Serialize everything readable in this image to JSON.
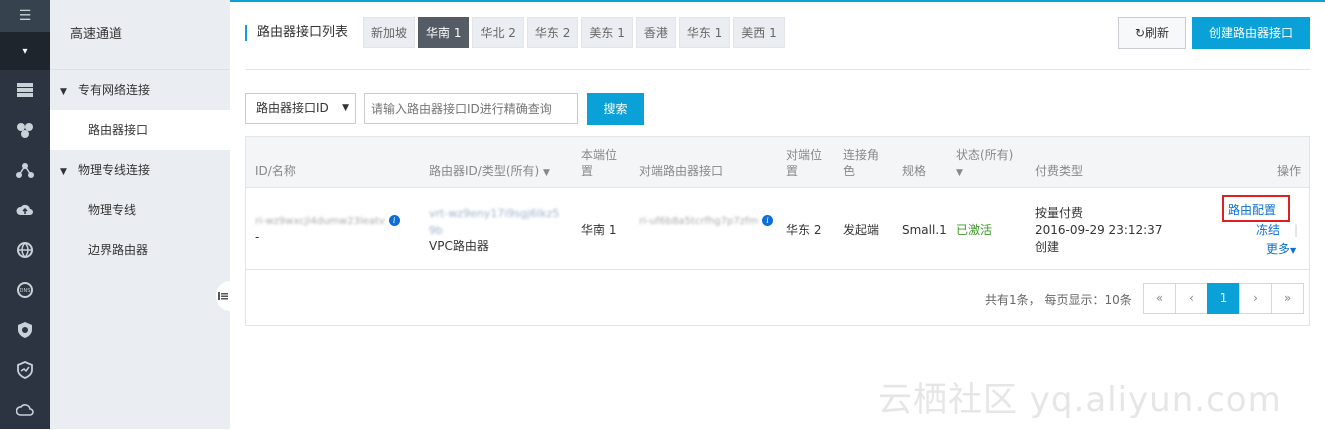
{
  "iconbar": {
    "menu_glyph": "☰",
    "collapse_glyph": "▾",
    "icons": [
      "server-icon",
      "cluster-icon",
      "network-icon",
      "cloud-upload-icon",
      "globe-icon",
      "dns-icon",
      "shield-icon",
      "security-icon",
      "cloud-icon"
    ]
  },
  "subnav": {
    "title": "高速通道",
    "group1": "专有网络连接",
    "item_router_iface": "路由器接口",
    "group2": "物理专线连接",
    "item_physical": "物理专线",
    "item_border": "边界路由器"
  },
  "header": {
    "title": "路由器接口列表",
    "regions": [
      "新加坡",
      "华南 1",
      "华北 2",
      "华东 2",
      "美东 1",
      "香港",
      "华东 1",
      "美西 1"
    ],
    "active_region": "华南 1",
    "refresh_label": "刷新",
    "create_label": "创建路由器接口"
  },
  "search": {
    "select_value": "路由器接口ID",
    "placeholder": "请输入路由器接口ID进行精确查询",
    "button_label": "搜索"
  },
  "table": {
    "headers": {
      "id_name": "ID/名称",
      "router": "路由器ID/类型(所有)",
      "local_pos": "本端位\n置",
      "peer_iface": "对端路由器接口",
      "peer_pos": "对端位\n置",
      "role": "连接角\n色",
      "spec": "规格",
      "status": "状态(所有)",
      "billing": "付费类型",
      "ops": "操作"
    },
    "row": {
      "id": "ri-wz9wxcjl4dumw23leatv",
      "name": "-",
      "router_id": "vrt-wz9eny17i9sgj6lkz59b",
      "router_type": "VPC路由器",
      "local_pos": "华南 1",
      "peer_iface": "ri-uf6b8a5tcrfhg7p7zfm",
      "peer_pos": "华东 2",
      "role": "发起端",
      "spec": "Small.1",
      "status": "已激活",
      "billing_type": "按量付费",
      "billing_time": "2016-09-29 23:12:37",
      "billing_note": "创建",
      "op_config": "路由配置",
      "op_freeze": "冻结",
      "op_more": "更多"
    }
  },
  "pagination": {
    "summary": "共有1条， 每页显示：10条",
    "first": "«",
    "prev": "‹",
    "current": "1",
    "next": "›",
    "last": "»"
  },
  "watermark": "云栖社区 yq.aliyun.com",
  "colors": {
    "accent": "#0aa0d8",
    "sidebar_dark": "#2b3440",
    "active_green": "#3d9a2b",
    "highlight_red": "#e02020"
  }
}
